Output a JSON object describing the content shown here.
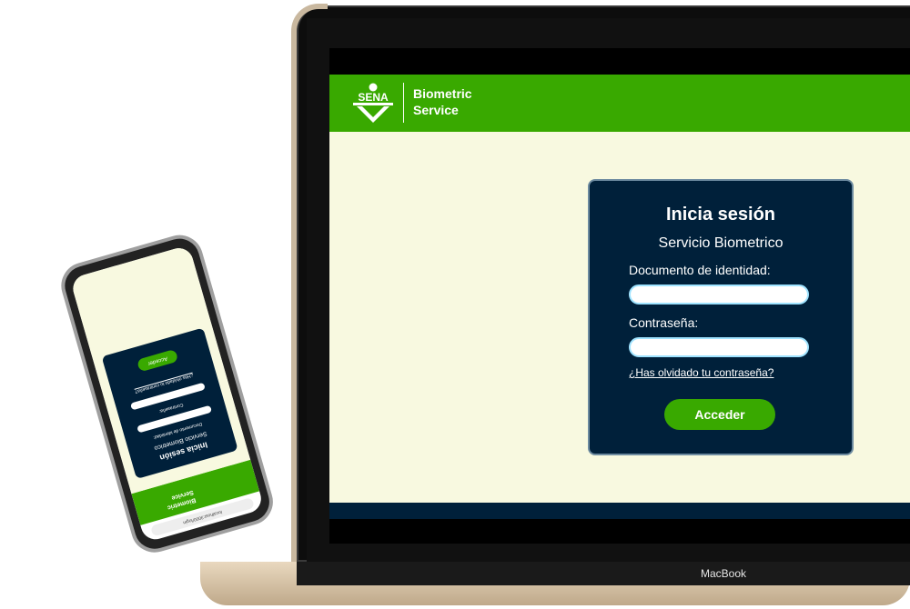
{
  "app": {
    "brand_logo_text": "SENA",
    "brand_line1": "Biometric",
    "brand_line2": "Service"
  },
  "login": {
    "title": "Inicia sesión",
    "subtitle": "Servicio Biometrico",
    "document_label": "Documento de identidad:",
    "document_value": "",
    "password_label": "Contraseña:",
    "password_value": "",
    "forgot_link": "¿Has olvidado tu contraseña?",
    "submit_label": "Acceder"
  },
  "device": {
    "laptop_label": "MacBook"
  },
  "phone": {
    "url": "localhost:3000/login",
    "title": "Inicia sesión",
    "subtitle": "Servicio Biometrico",
    "document_label": "Documento de identidad:",
    "password_label": "Contraseña:",
    "forgot_link": "¿Has olvidado tu contraseña?",
    "submit_label": "Acceder",
    "brand_line1": "Biometric",
    "brand_line2": "Service"
  },
  "colors": {
    "brand_green": "#39a900",
    "navy": "#00203a",
    "cream": "#f8f9e0"
  }
}
